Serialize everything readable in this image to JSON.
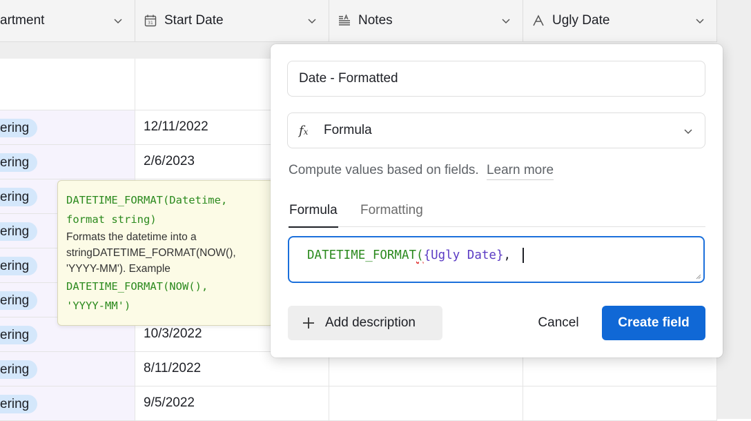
{
  "columns": {
    "department": {
      "label": "artment"
    },
    "start_date": {
      "label": "Start Date",
      "icon": "calendar-icon"
    },
    "notes": {
      "label": "Notes",
      "icon": "long-text-icon"
    },
    "ugly_date": {
      "label": "Ugly Date",
      "icon": "text-a-icon"
    }
  },
  "rows": [
    {
      "department": "ering",
      "start_date": "12/11/2022"
    },
    {
      "department": "ering",
      "start_date": "2/6/2023"
    },
    {
      "department": "ering",
      "start_date": ""
    },
    {
      "department": "ering",
      "start_date": ""
    },
    {
      "department": "ering",
      "start_date": ""
    },
    {
      "department": "ering",
      "start_date": ""
    },
    {
      "department": "ering",
      "start_date": "10/3/2022"
    },
    {
      "department": "ering",
      "start_date": "8/11/2022"
    },
    {
      "department": "ering",
      "start_date": "9/5/2022"
    }
  ],
  "tooltip": {
    "signature_line1": "DATETIME_FORMAT(Datetime,",
    "signature_line2": "format string)",
    "description_line1": "Formats the datetime into a",
    "description_line2": "stringDATETIME_FORMAT(NOW(),",
    "description_line3": "'YYYY-MM'). Example",
    "example_line1": "DATETIME_FORMAT(NOW(),",
    "example_line2": "'YYYY-MM')"
  },
  "dialog": {
    "field_name_value": "Date - Formatted",
    "field_type": "Formula",
    "field_type_icon": "formula-fx-icon",
    "helper_text": "Compute values based on fields.",
    "learn_more": "Learn more",
    "tabs": {
      "formula": "Formula",
      "formatting": "Formatting"
    },
    "active_tab": "Formula",
    "formula": {
      "fn": "DATETIME_FORMAT",
      "paren": "(",
      "ref": "{Ugly Date}",
      "rest": ", "
    },
    "add_description": "Add description",
    "cancel": "Cancel",
    "create": "Create field"
  },
  "colors": {
    "accent": "#1068d6",
    "pill": "#d4e7fb",
    "tooltip_bg": "#fcfbe6",
    "function_green": "#2b8a1e",
    "reference_purple": "#5b3bc4"
  }
}
